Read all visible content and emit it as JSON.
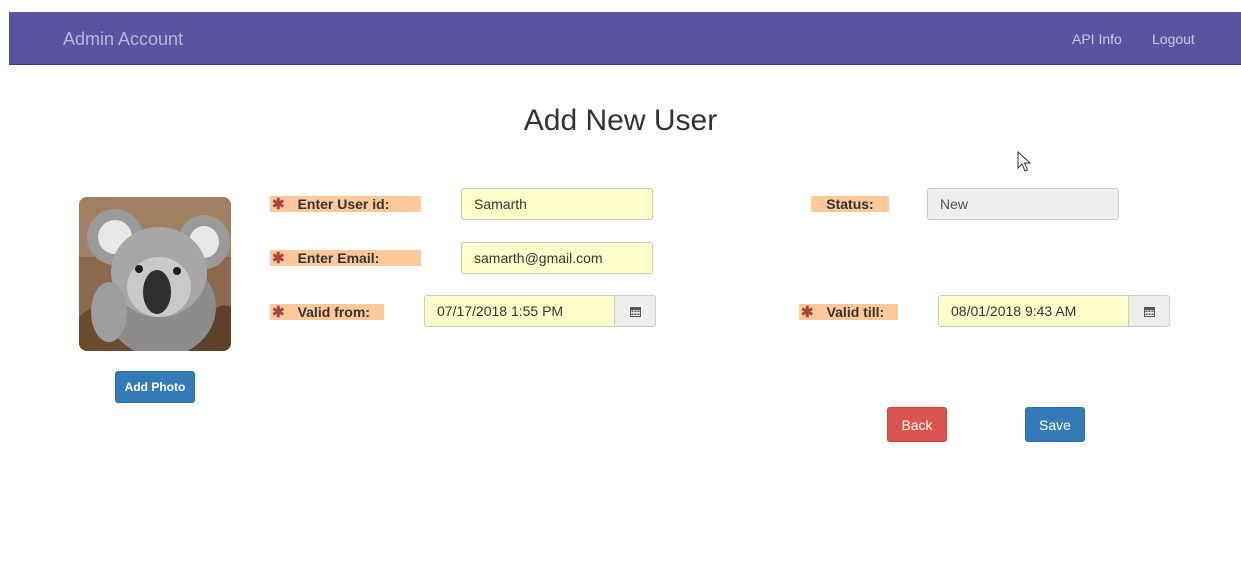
{
  "navbar": {
    "brand": "Admin Account",
    "links": [
      "API Info",
      "Logout"
    ]
  },
  "page": {
    "title": "Add New User"
  },
  "photo": {
    "button_label": "Add Photo",
    "alt": "koala"
  },
  "form": {
    "userid": {
      "label": "Enter User id:",
      "value": "Samarth"
    },
    "email": {
      "label": "Enter Email:",
      "value": "samarth@gmail.com"
    },
    "valid_from": {
      "label": "Valid from:",
      "value": "07/17/2018 1:55 PM"
    },
    "status": {
      "label": "Status:",
      "value": "New"
    },
    "valid_till": {
      "label": "Valid till:",
      "value": "08/01/2018 9:43 AM"
    },
    "required_marker": "✱"
  },
  "actions": {
    "back": "Back",
    "save": "Save"
  },
  "colors": {
    "navbar": "#5a53a0",
    "label_bg": "#fdc99a",
    "input_bg": "#ffffcc",
    "primary": "#337ab7",
    "danger": "#d9534f"
  },
  "icons": {
    "calendar": "calendar-icon",
    "cursor": "mouse-cursor-icon"
  }
}
